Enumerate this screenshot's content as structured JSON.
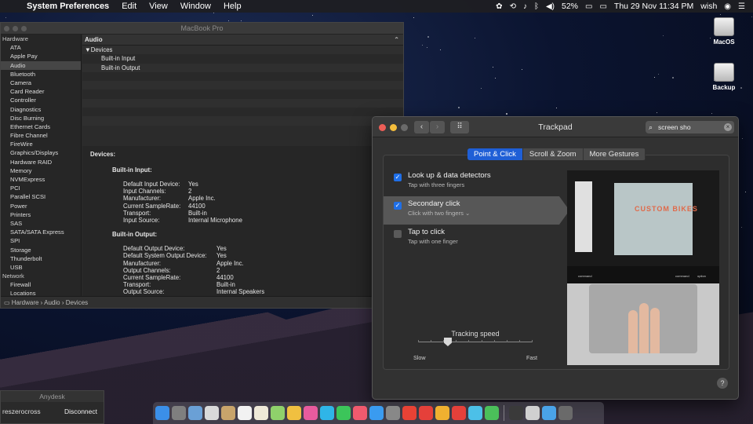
{
  "menubar": {
    "app": "System Preferences",
    "menus": [
      "Edit",
      "View",
      "Window",
      "Help"
    ],
    "battery": "52%",
    "clock": "Thu 29 Nov  11:34 PM",
    "user": "wish"
  },
  "desktop": {
    "icons": [
      "MacOS",
      "Backup"
    ]
  },
  "sysinfo": {
    "window_title": "MacBook Pro",
    "sidebar": [
      {
        "label": "Hardware",
        "cat": true
      },
      {
        "label": "ATA"
      },
      {
        "label": "Apple Pay"
      },
      {
        "label": "Audio",
        "selected": true
      },
      {
        "label": "Bluetooth"
      },
      {
        "label": "Camera"
      },
      {
        "label": "Card Reader"
      },
      {
        "label": "Controller"
      },
      {
        "label": "Diagnostics"
      },
      {
        "label": "Disc Burning"
      },
      {
        "label": "Ethernet Cards"
      },
      {
        "label": "Fibre Channel"
      },
      {
        "label": "FireWire"
      },
      {
        "label": "Graphics/Displays"
      },
      {
        "label": "Hardware RAID"
      },
      {
        "label": "Memory"
      },
      {
        "label": "NVMExpress"
      },
      {
        "label": "PCI"
      },
      {
        "label": "Parallel SCSI"
      },
      {
        "label": "Power"
      },
      {
        "label": "Printers"
      },
      {
        "label": "SAS"
      },
      {
        "label": "SATA/SATA Express"
      },
      {
        "label": "SPI"
      },
      {
        "label": "Storage"
      },
      {
        "label": "Thunderbolt"
      },
      {
        "label": "USB"
      },
      {
        "label": "Network",
        "cat": true
      },
      {
        "label": "Firewall"
      },
      {
        "label": "Locations"
      }
    ],
    "table_header": "Audio",
    "tree": [
      "▼Devices",
      "Built-in Input",
      "Built-in Output"
    ],
    "detail": {
      "heading": "Devices:",
      "input_title": "Built-in Input:",
      "input_rows": [
        [
          "Default Input Device:",
          "Yes"
        ],
        [
          "Input Channels:",
          "2"
        ],
        [
          "Manufacturer:",
          "Apple Inc."
        ],
        [
          "Current SampleRate:",
          "44100"
        ],
        [
          "Transport:",
          "Built-in"
        ],
        [
          "Input Source:",
          "Internal Microphone"
        ]
      ],
      "output_title": "Built-in Output:",
      "output_rows": [
        [
          "Default Output Device:",
          "Yes"
        ],
        [
          "Default System Output Device:",
          "Yes"
        ],
        [
          "Manufacturer:",
          "Apple Inc."
        ],
        [
          "Output Channels:",
          "2"
        ],
        [
          "Current SampleRate:",
          "44100"
        ],
        [
          "Transport:",
          "Built-in"
        ],
        [
          "Output Source:",
          "Internal Speakers"
        ]
      ]
    },
    "path": "Hardware  ›  Audio  ›  Devices"
  },
  "trackpad": {
    "title": "Trackpad",
    "search_value": "screen sho",
    "tabs": [
      "Point & Click",
      "Scroll & Zoom",
      "More Gestures"
    ],
    "active_tab": 0,
    "options": [
      {
        "title": "Look up & data detectors",
        "sub": "Tap with three fingers",
        "checked": true,
        "selected": false
      },
      {
        "title": "Secondary click",
        "sub": "Click with two fingers ⌄",
        "checked": true,
        "selected": true
      },
      {
        "title": "Tap to click",
        "sub": "Tap with one finger",
        "checked": false,
        "selected": false
      }
    ],
    "slider": {
      "label": "Tracking speed",
      "min_label": "Slow",
      "max_label": "Fast",
      "value_fraction": 0.26
    },
    "preview_text": "CUSTOM BIKES",
    "key_labels": [
      "command",
      "command",
      "option"
    ]
  },
  "anydesk": {
    "title": "Anydesk",
    "name": "reszerocross",
    "button": "Disconnect"
  },
  "dock": {
    "apps": [
      "#3b8fe8",
      "#7f7f7f",
      "#6aa0d6",
      "#d9d9d9",
      "#c8a46b",
      "#f2f2f2",
      "#efe9d8",
      "#8fd16b",
      "#f0c040",
      "#e85b9e",
      "#2fb5e8",
      "#3cc55a",
      "#f05a6e",
      "#3a9bf0",
      "#888888",
      "#e94235",
      "#e5403a",
      "#f0b030",
      "#e5403a",
      "#4cc0e8",
      "#4bbf5a",
      "#3a3a3a",
      "#d0d0d0",
      "#4aa3e8",
      "#6a6a6a"
    ]
  }
}
